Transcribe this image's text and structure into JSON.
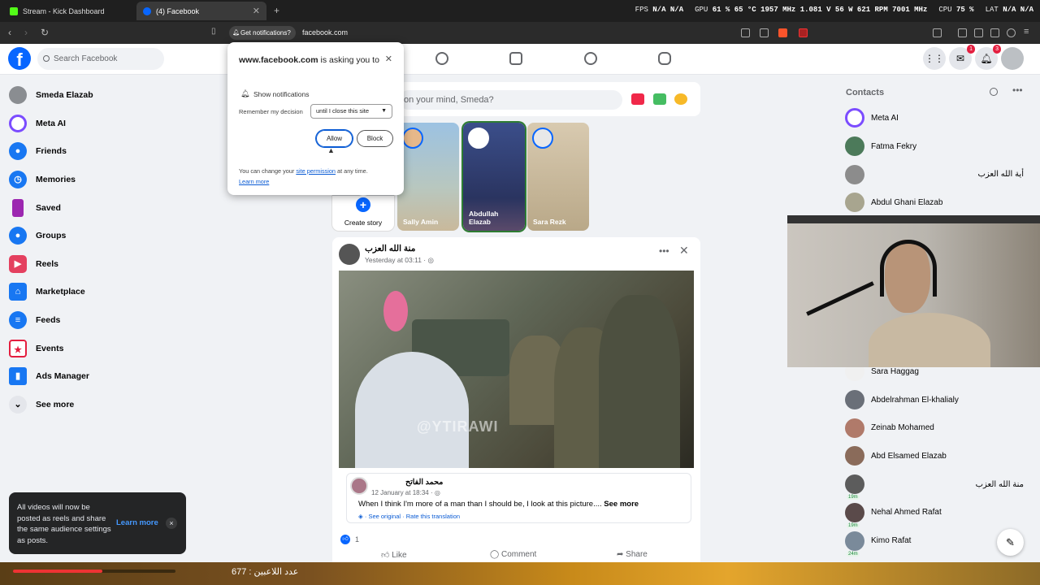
{
  "browser": {
    "tabs": [
      {
        "title": "Stream - Kick Dashboard",
        "favicon_color": "#53fc18"
      },
      {
        "title": "(4) Facebook",
        "favicon_color": "#0866ff"
      }
    ],
    "new_tab": "+",
    "hud": {
      "fps_label": "FPS",
      "fps_val1": "N/A",
      "fps_val2": "N/A",
      "gpu_label": "GPU",
      "gpu_val": "61 % 65 °C 1957 MHz 1.081 V 56 W 621 RPM 7001 MHz",
      "cpu_label": "CPU",
      "cpu_val": "75 %",
      "lat_label": "LAT",
      "lat_val": "N/A",
      "lat_val2": "N/A"
    },
    "get_notifications": "Get notifications?",
    "url": "facebook.com"
  },
  "fb": {
    "logo": "f",
    "search_placeholder": "Search Facebook",
    "messenger_badge": "1",
    "notif_badge": "3"
  },
  "left_nav": [
    {
      "label": "Smeda Elazab",
      "icon": "avatar",
      "color": "#8a8d91"
    },
    {
      "label": "Meta AI",
      "icon": "meta-ai-icon",
      "color": "#7b4cff"
    },
    {
      "label": "Friends",
      "icon": "friends-icon",
      "color": "#1877f2"
    },
    {
      "label": "Memories",
      "icon": "memories-icon",
      "color": "#1877f2"
    },
    {
      "label": "Saved",
      "icon": "saved-icon",
      "color": "#9c27b0"
    },
    {
      "label": "Groups",
      "icon": "groups-icon",
      "color": "#1877f2"
    },
    {
      "label": "Reels",
      "icon": "reels-icon",
      "color": "#e4405f"
    },
    {
      "label": "Marketplace",
      "icon": "marketplace-icon",
      "color": "#1877f2"
    },
    {
      "label": "Feeds",
      "icon": "feeds-icon",
      "color": "#1877f2"
    },
    {
      "label": "Events",
      "icon": "events-icon",
      "color": "#e41e3f"
    },
    {
      "label": "Ads Manager",
      "icon": "ads-manager-icon",
      "color": "#1877f2"
    },
    {
      "label": "See more",
      "icon": "chevron-down-icon",
      "color": "#e4e6eb"
    }
  ],
  "notif_popup": {
    "title_site": "www.facebook.com",
    "title_rest": " is asking you to",
    "show_notifications": "Show notifications",
    "remember": "Remember my decision",
    "select_value": "until I close this site",
    "allow": "Allow",
    "block": "Block",
    "note_prefix": "You can change your ",
    "note_link": "site permission",
    "note_suffix": " at any time.",
    "learn_more": "Learn more"
  },
  "composer": {
    "placeholder": "on your mind, Smeda?"
  },
  "stories": [
    {
      "name": "Create story",
      "bg": "#ffffff"
    },
    {
      "name": "Sally Amin",
      "bg": "#7aa2c4"
    },
    {
      "name": "Abdullah Elazab",
      "bg": "#4a5d9a"
    },
    {
      "name": "Sara Rezk",
      "bg": "#c9b99a"
    }
  ],
  "post": {
    "author": "منة الله العزب",
    "time": "Yesterday at 03:11 ·",
    "watermark": "@YTIRAWI",
    "shared_author": "محمد الفاتح",
    "shared_time": "12 January at 18:34 ·",
    "shared_text": "When I think I'm more of a man than I should be, I look at this picture....",
    "see_more": "See more",
    "see_original": "· See original",
    "rate_translation": "· Rate this translation",
    "like_count": "1",
    "actions": [
      "Like",
      "Comment",
      "Share"
    ]
  },
  "contacts": {
    "title": "Contacts",
    "list": [
      {
        "name": "Meta AI",
        "rtl": false,
        "color": "#7b4cff",
        "badge": ""
      },
      {
        "name": "Fatma Fekry",
        "rtl": false,
        "color": "#4c7a5a",
        "badge": ""
      },
      {
        "name": "أية الله العزب",
        "rtl": true,
        "color": "#8c8c8c",
        "badge": ""
      },
      {
        "name": "Abdul Ghani Elazab",
        "rtl": false,
        "color": "#a8a58f",
        "badge": ""
      },
      {
        "name": "Sara Haggag",
        "rtl": false,
        "color": "#f0f0f0",
        "badge": ""
      },
      {
        "name": "Abdelrahman El-khalialy",
        "rtl": false,
        "color": "#6a6f78",
        "badge": ""
      },
      {
        "name": "Zeinab Mohamed",
        "rtl": false,
        "color": "#b07a6a",
        "badge": ""
      },
      {
        "name": "Abd Elsamed Elazab",
        "rtl": false,
        "color": "#8a6b5a",
        "badge": ""
      },
      {
        "name": "منة الله العزب",
        "rtl": true,
        "color": "#5c5c5c",
        "badge": "19m"
      },
      {
        "name": "Nehal Ahmed Rafat",
        "rtl": false,
        "color": "#5a4a4a",
        "badge": "19m"
      },
      {
        "name": "Kimo Rafat",
        "rtl": false,
        "color": "#7a8a9a",
        "badge": "24m"
      }
    ]
  },
  "overlay": {
    "player_count": "677 : عدد اللاعبين"
  },
  "toast": {
    "text": "All videos will now be posted as reels and share the same audience settings as posts.",
    "learn_more": "Learn more",
    "close": "×"
  }
}
